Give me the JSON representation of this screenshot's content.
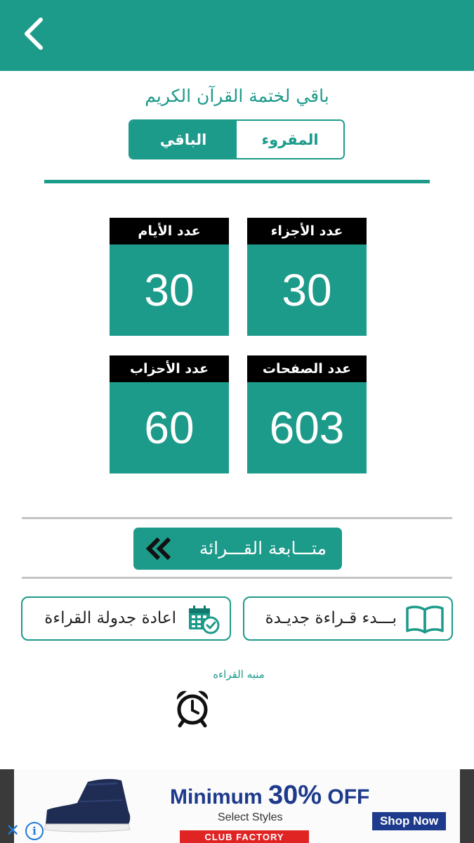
{
  "header": {
    "back_icon": "chevron-left-icon"
  },
  "title": "باقي لختمة القرآن الكريم",
  "tabs": {
    "read": "المقروء",
    "remaining": "الباقي",
    "active": "remaining"
  },
  "stats": [
    {
      "label": "عدد الأجزاء",
      "value": "30"
    },
    {
      "label": "عدد الأيام",
      "value": "30"
    },
    {
      "label": "عدد الصفحات",
      "value": "603"
    },
    {
      "label": "عدد الأحزاب",
      "value": "60"
    }
  ],
  "continue_button": {
    "label": "متـــابعة القـــرائة",
    "icon": "double-chevron-left-icon"
  },
  "new_reading_button": {
    "label": "بـــدء قـراءة جديـدة",
    "icon": "open-book-icon"
  },
  "reschedule_button": {
    "label": "اعادة جدولة القراءة",
    "icon": "calendar-clock-icon"
  },
  "alarm": {
    "label": "منبه القراءه",
    "icon": "alarm-clock-icon"
  },
  "ad": {
    "headline_prefix": "Minimum ",
    "headline_big": "30%",
    "headline_suffix": " OFF",
    "subtext": "Select Styles",
    "cta": "Shop Now",
    "brand": "CLUB FACTORY",
    "close_glyph": "✕",
    "info_glyph": "i"
  },
  "colors": {
    "primary": "#1c9a8a",
    "label_bg": "#000000",
    "ad_blue": "#1d3a8c",
    "ad_red": "#e02424"
  }
}
